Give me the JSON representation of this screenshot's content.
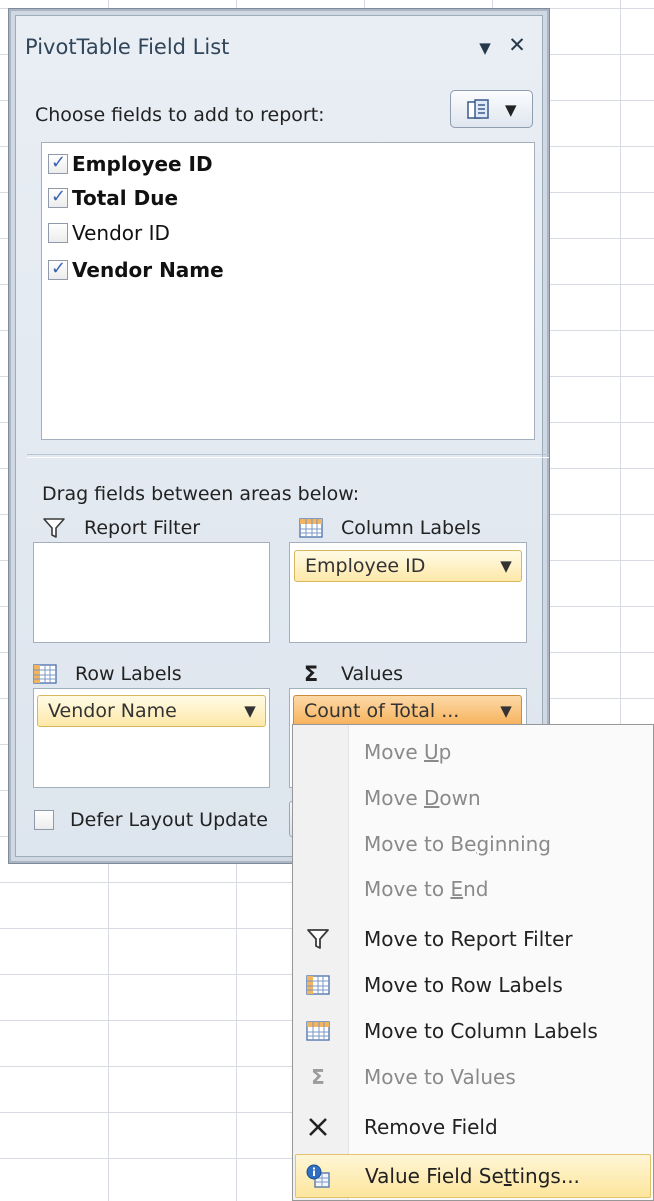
{
  "panel": {
    "title": "PivotTable Field List",
    "choose_label": "Choose fields to add to report:",
    "drag_label": "Drag fields between areas below:",
    "defer_label": "Defer Layout Update"
  },
  "fields": [
    {
      "label": "Employee ID",
      "checked": true
    },
    {
      "label": "Total Due",
      "checked": true
    },
    {
      "label": "Vendor ID",
      "checked": false
    },
    {
      "label": "Vendor Name",
      "checked": true
    }
  ],
  "areas": {
    "report_filter": {
      "label": "Report Filter",
      "icon": "filter-icon"
    },
    "column_labels": {
      "label": "Column Labels",
      "icon": "column-labels-icon",
      "items": [
        "Employee ID"
      ]
    },
    "row_labels": {
      "label": "Row Labels",
      "icon": "row-labels-icon",
      "items": [
        "Vendor Name"
      ]
    },
    "values": {
      "label": "Values",
      "icon": "sigma-icon",
      "items": [
        "Count of Total ..."
      ]
    }
  },
  "menu": {
    "items": [
      {
        "pre": "Move ",
        "key": "U",
        "post": "p",
        "disabled": true,
        "icon": ""
      },
      {
        "pre": "Move ",
        "key": "D",
        "post": "own",
        "disabled": true,
        "icon": ""
      },
      {
        "pre": "Move to Be",
        "key": "g",
        "post": "inning",
        "disabled": true,
        "icon": ""
      },
      {
        "pre": "Move to ",
        "key": "E",
        "post": "nd",
        "disabled": true,
        "icon": ""
      },
      {
        "pre": "Move to Report Filter",
        "key": "",
        "post": "",
        "disabled": false,
        "icon": "filter-icon"
      },
      {
        "pre": "Move to Row Labels",
        "key": "",
        "post": "",
        "disabled": false,
        "icon": "row-labels-icon"
      },
      {
        "pre": "Move to Column Labels",
        "key": "",
        "post": "",
        "disabled": false,
        "icon": "column-labels-icon"
      },
      {
        "pre": "Move to Values",
        "key": "",
        "post": "",
        "disabled": true,
        "icon": "sigma-icon"
      },
      {
        "pre": "Remove Field",
        "key": "",
        "post": "",
        "disabled": false,
        "icon": "remove-x-icon"
      },
      {
        "pre": "Value Field Se",
        "key": "t",
        "post": "tings...",
        "disabled": false,
        "icon": "value-settings-icon",
        "highlight": true
      }
    ]
  },
  "colors": {
    "panel_bg": "#dde5ee",
    "pill_yellow": "#fde8a8",
    "pill_orange": "#f7b15a",
    "checkbox_check": "#3964b5",
    "menu_highlight": "#fde59c"
  }
}
